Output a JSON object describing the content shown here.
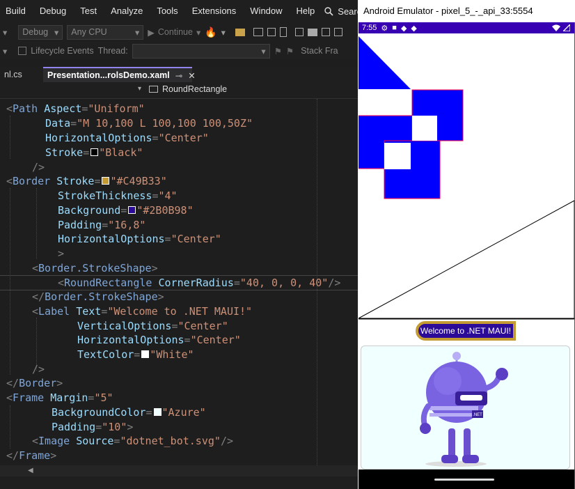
{
  "menu": [
    "Build",
    "Debug",
    "Test",
    "Analyze",
    "Tools",
    "Extensions",
    "Window",
    "Help"
  ],
  "search_label": "Search",
  "toolbar": {
    "config": "Debug",
    "platform": "Any CPU",
    "continue_label": "Continue"
  },
  "toolbar2": {
    "lifecycle_label": "Lifecycle Events",
    "thread_label": "Thread:",
    "stackframe_label": "Stack Fra"
  },
  "tabs": [
    {
      "label": "nl.cs",
      "active": false
    },
    {
      "label": "Presentation...rolsDemo.xaml",
      "active": true
    }
  ],
  "nav": {
    "member": "RoundRectangle"
  },
  "code": {
    "l1": {
      "tag": "Path",
      "attr": "Aspect",
      "val": "\"Uniform\""
    },
    "l2": {
      "attr": "Data",
      "val": "\"M 10,100 L 100,100 100,50Z\""
    },
    "l3": {
      "attr": "HorizontalOptions",
      "val": "\"Center\""
    },
    "l4": {
      "attr": "Stroke",
      "val": "\"Black\""
    },
    "l6": {
      "tag": "Border",
      "attr": "Stroke",
      "val": "\"#C49B33\""
    },
    "l7": {
      "attr": "StrokeThickness",
      "val": "\"4\""
    },
    "l8": {
      "attr": "Background",
      "val": "\"#2B0B98\""
    },
    "l9": {
      "attr": "Padding",
      "val": "\"16,8\""
    },
    "l10": {
      "attr": "HorizontalOptions",
      "val": "\"Center\""
    },
    "l12": {
      "tag": "Border.StrokeShape"
    },
    "l13": {
      "tag": "RoundRectangle",
      "attr": "CornerRadius",
      "val": "\"40, 0, 0, 40\""
    },
    "l14": {
      "tag": "Border.StrokeShape"
    },
    "l15": {
      "tag": "Label",
      "attr": "Text",
      "val": "\"Welcome to .NET MAUI!\""
    },
    "l16": {
      "attr": "VerticalOptions",
      "val": "\"Center\""
    },
    "l17": {
      "attr": "HorizontalOptions",
      "val": "\"Center\""
    },
    "l18": {
      "attr": "TextColor",
      "val": "\"White\""
    },
    "l20": {
      "tag": "Border"
    },
    "l21": {
      "tag": "Frame",
      "attr": "Margin",
      "val": "\"5\""
    },
    "l22": {
      "attr": "BackgroundColor",
      "val": "\"Azure\""
    },
    "l23": {
      "attr": "Padding",
      "val": "\"10\""
    },
    "l24": {
      "tag": "Image",
      "attr": "Source",
      "val": "\"dotnet_bot.svg\""
    },
    "l25": {
      "tag": "Frame"
    }
  },
  "swatches": {
    "black": "#000000",
    "stroke": "#C49B33",
    "background": "#2B0B98",
    "white": "#FFFFFF",
    "azure": "#F0FFFF"
  },
  "emulator": {
    "title": "Android Emulator - pixel_5_-_api_33:5554",
    "time": "7:55",
    "welcome_text": "Welcome to .NET MAUI!",
    "bot_badge": ".NET"
  }
}
